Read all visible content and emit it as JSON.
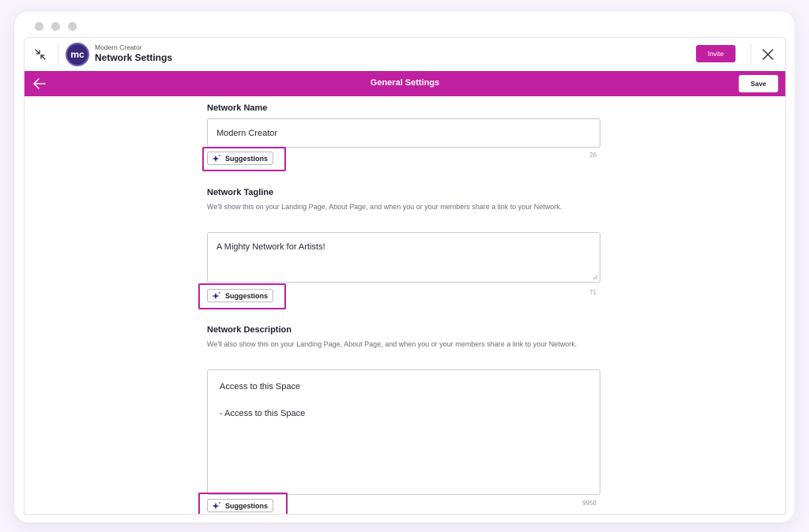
{
  "window": {
    "brand_subtitle": "Modern Creator",
    "title": "Network Settings",
    "logo_text": "mc",
    "invite_label": "Invite"
  },
  "header": {
    "title": "General Settings",
    "save_label": "Save"
  },
  "fields": {
    "name": {
      "label": "Network Name",
      "value": "Modern Creator",
      "counter": "26",
      "suggestions_label": "Suggestions"
    },
    "tagline": {
      "label": "Network Tagline",
      "help": "We'll show this on your Landing Page, About Page, and when you or your members share a link to your Network.",
      "value": "A Mighty Network for Artists!",
      "counter": "71",
      "suggestions_label": "Suggestions"
    },
    "description": {
      "label": "Network Description",
      "help": "We'll also show this on your Landing Page, About Page, and when you or your members share a link to your Network.",
      "value": "Access to this Space\n\n- Access to this Space",
      "counter": "9958",
      "suggestions_label": "Suggestions"
    }
  },
  "colors": {
    "accent": "#c0209f",
    "logo": "#3a2a7a"
  },
  "icons": [
    "collapse-icon",
    "close-icon",
    "back-arrow-icon",
    "sparkle-icon"
  ]
}
